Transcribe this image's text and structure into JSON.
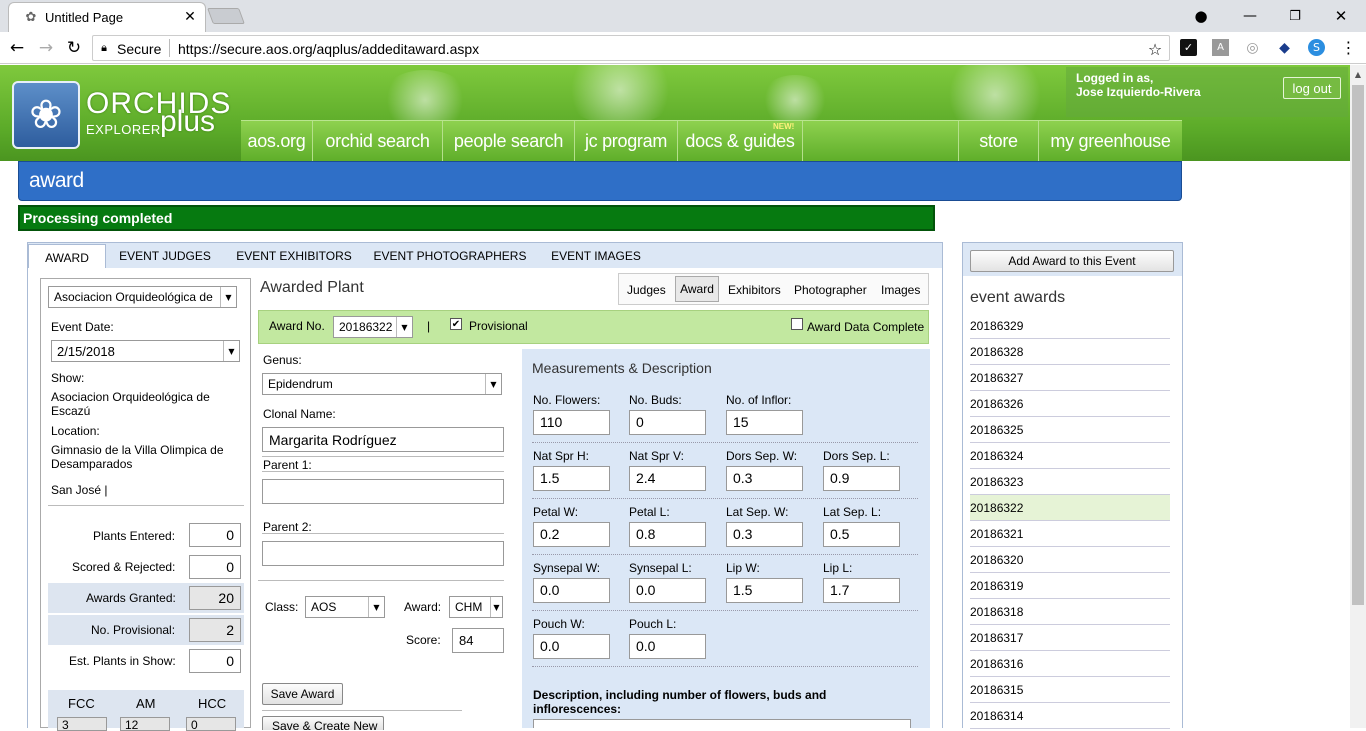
{
  "browser": {
    "tab_title": "Untitled Page",
    "secure_label": "Secure",
    "url": "https://secure.aos.org/aqplus/addeditaward.aspx"
  },
  "site": {
    "logo_main": "ORCHIDS",
    "logo_sub1": "EXPLORER",
    "logo_sub2": "plus",
    "logged_in_label": "Logged in as,",
    "user_name": "Jose Izquierdo-Rivera",
    "logout": "log out",
    "nav": [
      "aos.org",
      "orchid search",
      "people search",
      "jc program",
      "docs & guides",
      "store",
      "my greenhouse"
    ],
    "new_badge": "NEW!",
    "section_title": "award",
    "status": "Processing completed"
  },
  "tabs": [
    "AWARD",
    "EVENT JUDGES",
    "EVENT EXHIBITORS",
    "EVENT PHOTOGRAPHERS",
    "EVENT IMAGES"
  ],
  "left": {
    "society": "Asociacion Orquideológica de",
    "event_date_label": "Event Date:",
    "event_date": "2/15/2018",
    "show_label": "Show:",
    "show_line1": "Asociacion Orquideológica de",
    "show_line2": "Escazú",
    "location_label": "Location:",
    "location_line1": "Gimnasio de la Villa Olimpica de",
    "location_line2": "Desamparados",
    "city": "San José |",
    "stats": [
      {
        "label": "Plants Entered:",
        "value": "0"
      },
      {
        "label": "Scored & Rejected:",
        "value": "0"
      },
      {
        "label": "Awards Granted:",
        "value": "20"
      },
      {
        "label": "No. Provisional:",
        "value": "2"
      },
      {
        "label": "Est. Plants in Show:",
        "value": "0"
      }
    ],
    "award_types": [
      "FCC",
      "AM",
      "HCC"
    ],
    "award_counts": [
      "3",
      "12",
      "0"
    ]
  },
  "form": {
    "heading": "Awarded Plant",
    "subtabs": [
      "Judges",
      "Award",
      "Exhibitors",
      "Photographer",
      "Images"
    ],
    "award_no_label": "Award No.",
    "award_no": "20186322",
    "separator": "|",
    "provisional_label": "Provisional",
    "complete_label": "Award Data Complete",
    "genus_label": "Genus:",
    "genus": "Epidendrum",
    "clonal_label": "Clonal Name:",
    "clonal": "Margarita Rodríguez",
    "parent1_label": "Parent 1:",
    "parent2_label": "Parent 2:",
    "class_label": "Class:",
    "class_value": "AOS",
    "award_label": "Award:",
    "award_value": "CHM",
    "score_label": "Score:",
    "score": "84",
    "save_award": "Save Award",
    "save_create": "Save & Create New"
  },
  "measurements": {
    "title": "Measurements & Description",
    "rows": [
      [
        {
          "label": "No. Flowers:",
          "value": "110"
        },
        {
          "label": "No. Buds:",
          "value": "0"
        },
        {
          "label": "No. of Inflor:",
          "value": "15"
        }
      ],
      [
        {
          "label": "Nat Spr H:",
          "value": "1.5"
        },
        {
          "label": "Nat Spr V:",
          "value": "2.4"
        },
        {
          "label": "Dors Sep. W:",
          "value": "0.3"
        },
        {
          "label": "Dors Sep. L:",
          "value": "0.9"
        }
      ],
      [
        {
          "label": "Petal W:",
          "value": "0.2"
        },
        {
          "label": "Petal L:",
          "value": "0.8"
        },
        {
          "label": "Lat Sep. W:",
          "value": "0.3"
        },
        {
          "label": "Lat Sep. L:",
          "value": "0.5"
        }
      ],
      [
        {
          "label": "Synsepal W:",
          "value": "0.0"
        },
        {
          "label": "Synsepal L:",
          "value": "0.0"
        },
        {
          "label": "Lip W:",
          "value": "1.5"
        },
        {
          "label": "Lip L:",
          "value": "1.7"
        }
      ],
      [
        {
          "label": "Pouch W:",
          "value": "0.0"
        },
        {
          "label": "Pouch L:",
          "value": "0.0"
        }
      ]
    ],
    "desc_label_1": "Description, including number of flowers, buds and",
    "desc_label_2": "inflorescences:"
  },
  "right": {
    "add_button": "Add Award to this Event",
    "heading": "event awards",
    "awards": [
      "20186329",
      "20186328",
      "20186327",
      "20186326",
      "20186325",
      "20186324",
      "20186323",
      "20186322",
      "20186321",
      "20186320",
      "20186319",
      "20186318",
      "20186317",
      "20186316",
      "20186315",
      "20186314"
    ],
    "selected": "20186322"
  }
}
